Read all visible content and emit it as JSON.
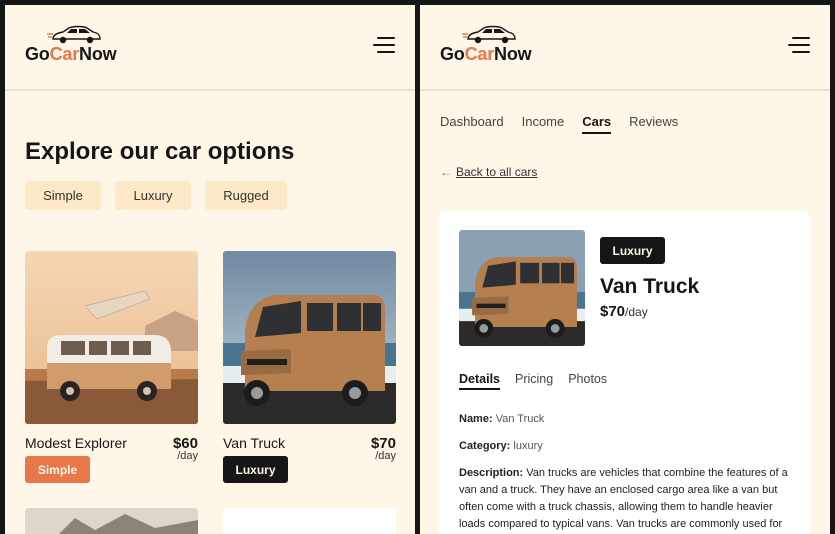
{
  "brand": {
    "logo_prefix": "Go",
    "logo_accent": "Car",
    "logo_suffix": "Now",
    "accent_color": "#e87749",
    "background": "#fef6e7"
  },
  "left": {
    "title": "Explore our car options",
    "filters": [
      "Simple",
      "Luxury",
      "Rugged"
    ],
    "cars": [
      {
        "name": "Modest Explorer",
        "price": "$60",
        "per": "/day",
        "badge": "Simple"
      },
      {
        "name": "Van Truck",
        "price": "$70",
        "per": "/day",
        "badge": "Luxury"
      }
    ]
  },
  "right": {
    "nav": [
      "Dashboard",
      "Income",
      "Cars",
      "Reviews"
    ],
    "nav_active": "Cars",
    "back_arrow": "←",
    "back_label": "Back to all cars",
    "detail": {
      "badge": "Luxury",
      "title": "Van Truck",
      "price": "$70",
      "price_unit": "/day",
      "subtabs": [
        "Details",
        "Pricing",
        "Photos"
      ],
      "subtab_active": "Details",
      "name_label": "Name:",
      "name_value": "Van Truck",
      "category_label": "Category:",
      "category_value": "luxury",
      "description_label": "Description:",
      "description_value": "Van trucks are vehicles that combine the features of a van and a truck. They have an enclosed cargo area like a van but often come with a truck chassis, allowing them to handle heavier loads compared to typical vans. Van trucks are commonly used for"
    }
  }
}
